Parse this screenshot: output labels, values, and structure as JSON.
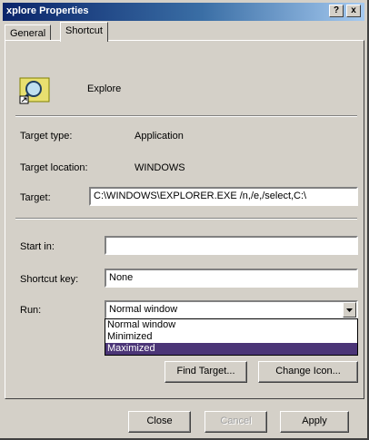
{
  "window": {
    "title": "xplore Properties",
    "help_button": "?",
    "close_button": "x"
  },
  "tabs": [
    {
      "label": "General"
    },
    {
      "label": "Shortcut"
    }
  ],
  "shortcut": {
    "name": "Explore",
    "target_type_label": "Target type:",
    "target_type_value": "Application",
    "target_location_label": "Target location:",
    "target_location_value": "WINDOWS",
    "target_label": "Target:",
    "target_value": "C:\\WINDOWS\\EXPLORER.EXE /n,/e,/select,C:\\",
    "start_in_label": "Start in:",
    "start_in_value": "",
    "shortcut_key_label": "Shortcut key:",
    "shortcut_key_value": "None",
    "run_label": "Run:",
    "run_value": "Normal window",
    "run_options": [
      "Normal window",
      "Minimized",
      "Maximized"
    ],
    "run_highlighted": "Maximized",
    "find_target_button": "Find Target...",
    "change_icon_button": "Change Icon..."
  },
  "footer": {
    "close_button": "Close",
    "cancel_button": "Cancel",
    "apply_button": "Apply"
  }
}
